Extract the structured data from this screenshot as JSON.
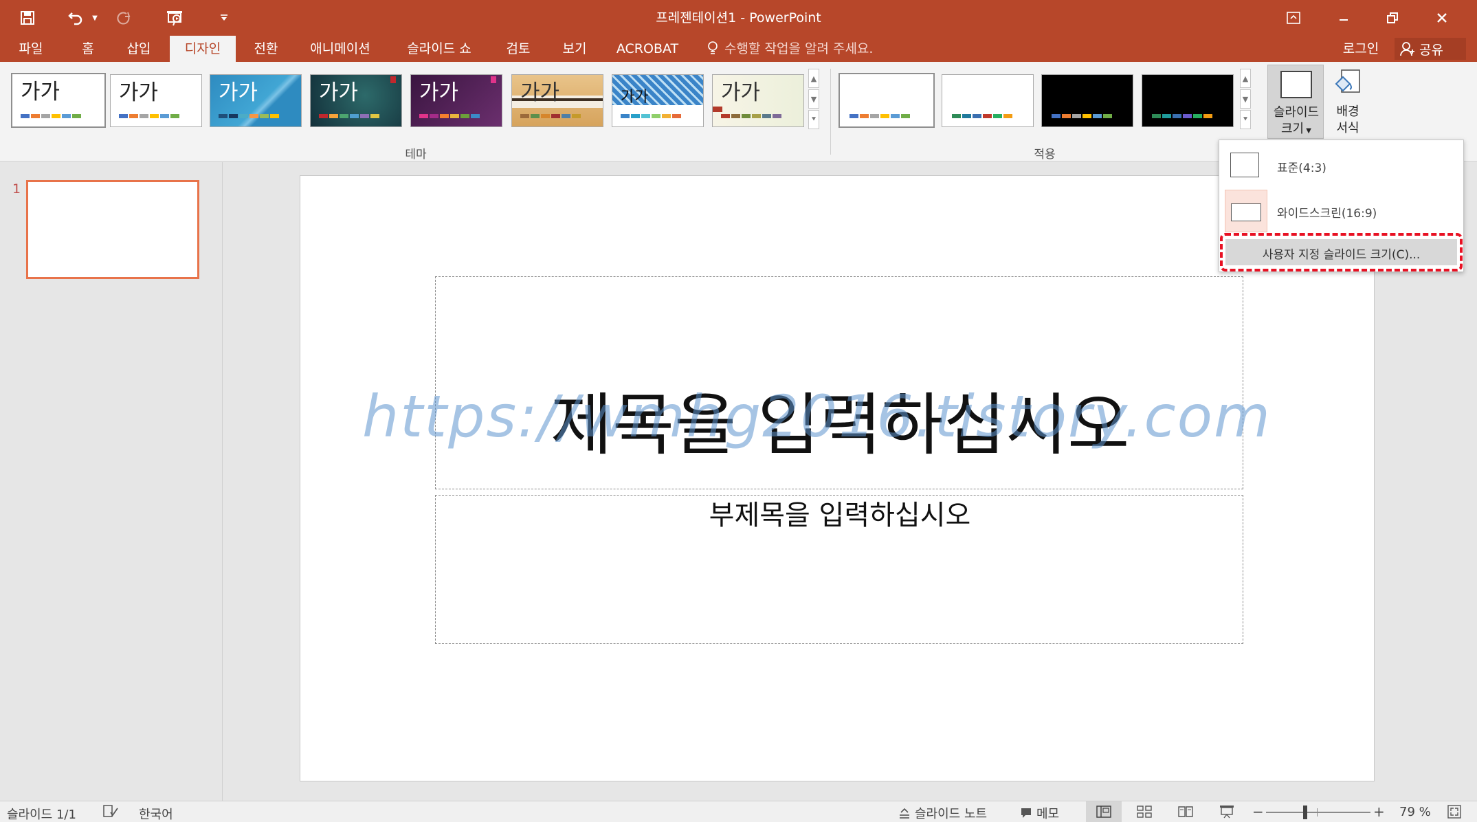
{
  "window": {
    "title": "프레젠테이션1 - PowerPoint"
  },
  "qat": {
    "save": "save-icon",
    "undo": "undo-icon",
    "redo": "redo-icon",
    "present": "present-from-start-icon",
    "customize": "customize-qat-icon"
  },
  "tabs": [
    "파일",
    "홈",
    "삽입",
    "디자인",
    "전환",
    "애니메이션",
    "슬라이드 쇼",
    "검토",
    "보기",
    "ACROBAT"
  ],
  "tell_me": "수행할 작업을 알려 주세요.",
  "account": {
    "login": "로그인",
    "share": "공유"
  },
  "themes": {
    "group_label": "테마",
    "sample_text": "가가",
    "items": [
      "Office 테마 1",
      "Office 테마 2",
      "Theme 3",
      "Theme 4",
      "Theme 5",
      "Theme 6",
      "Theme 7",
      "Theme 8"
    ]
  },
  "variants": {
    "group_label": "적용"
  },
  "slide_size": {
    "label_line1": "슬라이드",
    "label_line2": "크기"
  },
  "format_bg": {
    "label_line1": "배경",
    "label_line2": "서식"
  },
  "dropdown": {
    "standard": "표준(4:3)",
    "widescreen": "와이드스크린(16:9)",
    "custom": "사용자 지정 슬라이드 크기(C)..."
  },
  "slide_panel": {
    "number": "1"
  },
  "slide": {
    "title_placeholder": "제목을 입력하십시오",
    "subtitle_placeholder": "부제목을 입력하십시오",
    "watermark": "https://wmhg2016.tistory.com"
  },
  "status": {
    "slide_count": "슬라이드 1/1",
    "language": "한국어",
    "notes": "슬라이드 노트",
    "comments": "메모",
    "zoom": "79 %"
  },
  "colors": {
    "accent": "#b7472a",
    "highlight_border": "#e81123"
  }
}
